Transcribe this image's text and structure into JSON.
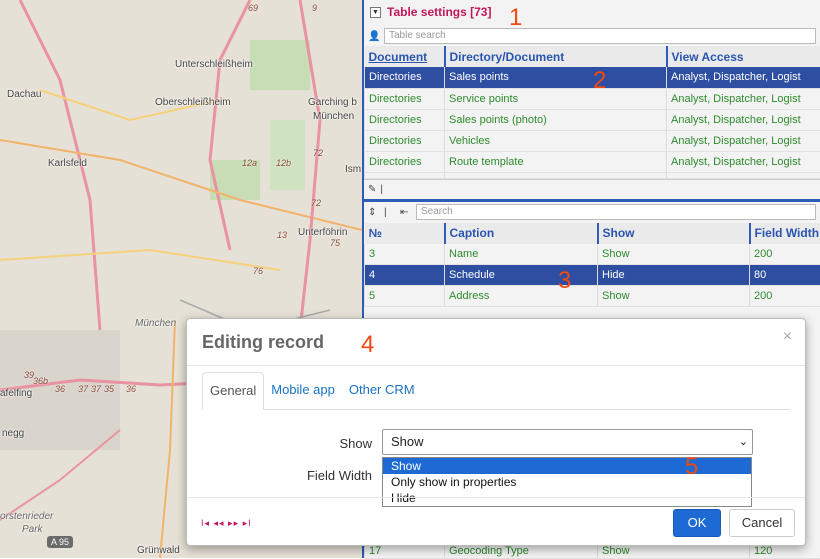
{
  "map": {
    "labels": [
      "Unterschleißheim",
      "Dachau",
      "Oberschleißheim",
      "Garching b",
      "München",
      "Karlsfeld",
      "Ism",
      "Unterföhrin",
      "München",
      "afelfing",
      "negg",
      "orstenrieder",
      "Park",
      "Grünwald"
    ],
    "road_numbers": [
      "9",
      "69",
      "12a",
      "12b",
      "72",
      "72",
      "75",
      "13",
      "76",
      "39",
      "36b",
      "36",
      "37",
      "37",
      "35",
      "36"
    ],
    "shield": "A 95"
  },
  "table_settings": {
    "title": "Table settings [73]",
    "search_placeholder": "Table search",
    "columns": [
      "Document",
      "Directory/Document",
      "View Access"
    ],
    "rows": [
      [
        "Directories",
        "Sales points",
        "Analyst, Dispatcher, Logist"
      ],
      [
        "Directories",
        "Service points",
        "Analyst, Dispatcher, Logist"
      ],
      [
        "Directories",
        "Sales points (photo)",
        "Analyst, Dispatcher, Logist"
      ],
      [
        "Directories",
        "Vehicles",
        "Analyst, Dispatcher, Logist"
      ],
      [
        "Directories",
        "Route template",
        "Analyst, Dispatcher, Logist"
      ]
    ],
    "selected_row": 0
  },
  "fields_grid": {
    "search_placeholder": "Search",
    "columns": [
      "№",
      "Caption",
      "Show",
      "Field Width"
    ],
    "rows": [
      [
        "3",
        "Name",
        "Show",
        "200"
      ],
      [
        "4",
        "Schedule",
        "Hide",
        "80"
      ],
      [
        "5",
        "Address",
        "Show",
        "200"
      ]
    ],
    "bottom_row": [
      "17",
      "Geocoding Type",
      "Show",
      "120"
    ],
    "selected_row": 1
  },
  "modal": {
    "title": "Editing record",
    "close": "×",
    "tabs": [
      "General",
      "Mobile app",
      "Other CRM"
    ],
    "show_label": "Show",
    "field_width_label": "Field Width",
    "select_value": "Show",
    "options": [
      "Show",
      "Only show in properties",
      "Hide"
    ],
    "pager": "I◂ ◂◂ ▸▸ ▸I",
    "ok": "OK",
    "cancel": "Cancel"
  },
  "callouts": [
    "1",
    "2",
    "3",
    "4",
    "5"
  ],
  "colors": {
    "accent": "#2e5cb8",
    "selection": "#2d4ea1",
    "title": "#c2185b",
    "link": "#2e8b2e",
    "callout": "#f04a10"
  }
}
